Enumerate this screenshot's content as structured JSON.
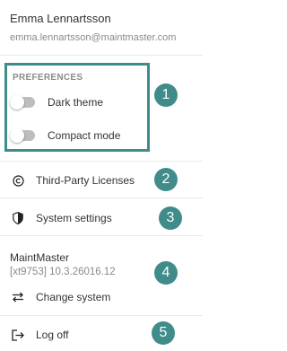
{
  "user": {
    "name": "Emma Lennartsson",
    "email": "emma.lennartsson@maintmaster.com"
  },
  "preferences": {
    "title": "PREFERENCES",
    "dark_theme_label": "Dark theme",
    "dark_theme_on": false,
    "compact_mode_label": "Compact mode",
    "compact_mode_on": false
  },
  "menu": {
    "licenses_label": "Third-Party Licenses",
    "system_settings_label": "System settings",
    "system_name": "MaintMaster",
    "system_version": "[xt9753] 10.3.26016.12",
    "change_system_label": "Change system",
    "logoff_label": "Log off"
  },
  "badges": [
    "1",
    "2",
    "3",
    "4",
    "5"
  ],
  "colors": {
    "accent": "#3f8c8a",
    "toggle_track_off": "#bdbdbd"
  },
  "icons": {
    "licenses": "copyright-icon",
    "system_settings": "shield-icon",
    "change_system": "swap-arrows-icon",
    "logoff": "logout-icon"
  }
}
